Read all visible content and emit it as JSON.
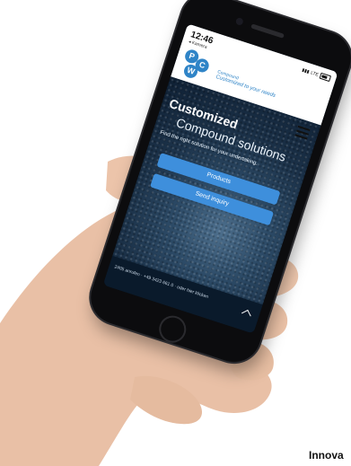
{
  "status": {
    "time": "12:46",
    "back": "◂ Kamera",
    "network": "LTE"
  },
  "brand": {
    "logo_letters": [
      "P",
      "C",
      "W"
    ],
    "name": "Compound",
    "tagline": "Customized to your needs"
  },
  "hero": {
    "title_bold": "Customized",
    "title_light": "Compound solutions",
    "tagline": "Find the right solution for your undertaking.",
    "btn_products": "Products",
    "btn_inquiry": "Send inquiry"
  },
  "footer": {
    "text": "2405 anrufen · +49 3423 661 0 · oder hier klicken"
  },
  "bottom_text": "Innova",
  "colors": {
    "accent": "#3e8fdc",
    "brand": "#2f84c7",
    "footer": "#0a1a2b"
  }
}
